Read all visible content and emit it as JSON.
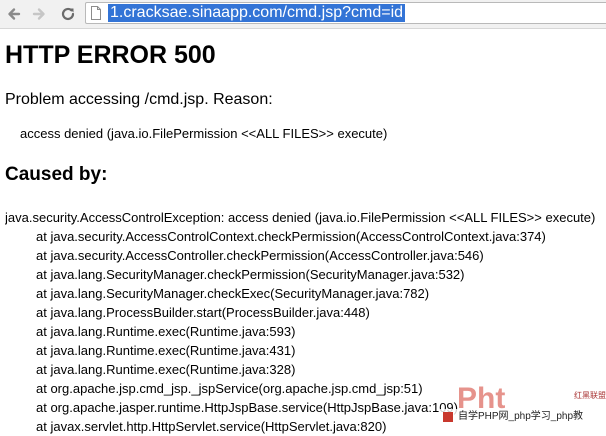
{
  "browser": {
    "url": "1.cracksae.sinaapp.com/cmd.jsp?cmd=id"
  },
  "page": {
    "title": "HTTP ERROR 500",
    "reason_heading": "Problem accessing /cmd.jsp. Reason:",
    "reason": "access denied (java.io.FilePermission <<ALL FILES>> execute)",
    "caused_by": "Caused by:",
    "exception": "java.security.AccessControlException: access denied (java.io.FilePermission <<ALL FILES>> execute)",
    "stack": [
      "at java.security.AccessControlContext.checkPermission(AccessControlContext.java:374)",
      "at java.security.AccessController.checkPermission(AccessController.java:546)",
      "at java.lang.SecurityManager.checkPermission(SecurityManager.java:532)",
      "at java.lang.SecurityManager.checkExec(SecurityManager.java:782)",
      "at java.lang.ProcessBuilder.start(ProcessBuilder.java:448)",
      "at java.lang.Runtime.exec(Runtime.java:593)",
      "at java.lang.Runtime.exec(Runtime.java:431)",
      "at java.lang.Runtime.exec(Runtime.java:328)",
      "at org.apache.jsp.cmd_jsp._jspService(org.apache.jsp.cmd_jsp:51)",
      "at org.apache.jasper.runtime.HttpJspBase.service(HttpJspBase.java:109)",
      "at javax.servlet.http.HttpServlet.service(HttpServlet.java:820)"
    ]
  },
  "watermark": {
    "logo": "Pht",
    "side_text": "红黑联盟",
    "text": "自学PHP网_php学习_php教"
  }
}
